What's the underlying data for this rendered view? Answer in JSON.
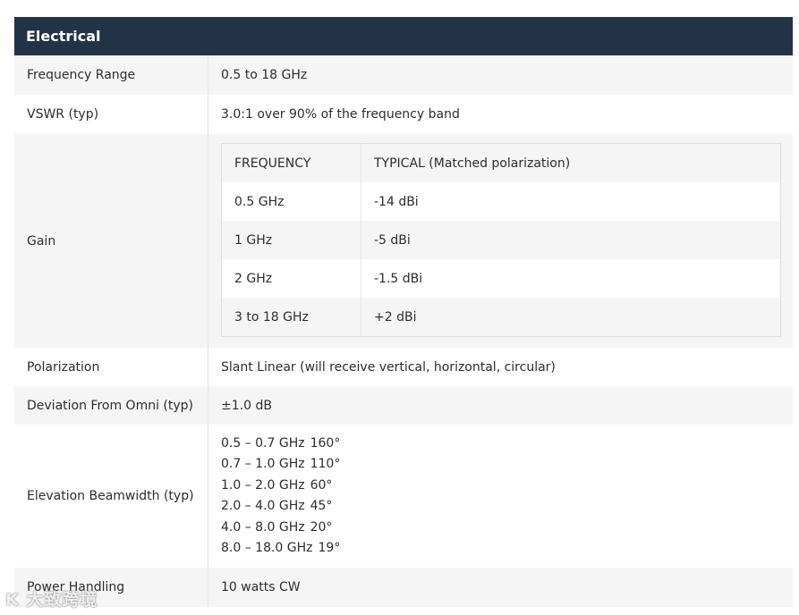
{
  "section_title": "Electrical",
  "rows": {
    "frequency_range": {
      "label": "Frequency Range",
      "value": "0.5 to 18 GHz"
    },
    "vswr": {
      "label": "VSWR (typ)",
      "value": "3.0:1 over 90% of the frequency band"
    },
    "gain": {
      "label": "Gain",
      "table": {
        "headers": [
          "FREQUENCY",
          "TYPICAL (Matched polarization)"
        ],
        "rows": [
          [
            "0.5 GHz",
            "-14 dBi"
          ],
          [
            "1 GHz",
            "-5 dBi"
          ],
          [
            "2 GHz",
            "-1.5 dBi"
          ],
          [
            "3 to 18 GHz",
            "+2 dBi"
          ]
        ]
      }
    },
    "polarization": {
      "label": "Polarization",
      "value": "Slant Linear (will receive vertical, horizontal, circular)"
    },
    "deviation": {
      "label": "Deviation From Omni (typ)",
      "value": "±1.0 dB"
    },
    "beamwidth": {
      "label": "Elevation Beamwidth (typ)",
      "lines": [
        {
          "range": "0.5 – 0.7 GHz",
          "angle": "160°"
        },
        {
          "range": "0.7 – 1.0 GHz",
          "angle": "110°"
        },
        {
          "range": "1.0 – 2.0 GHz",
          "angle": "60°"
        },
        {
          "range": "2.0 – 4.0 GHz",
          "angle": "45°"
        },
        {
          "range": "4.0 – 8.0 GHz",
          "angle": "20°"
        },
        {
          "range": "8.0 – 18.0 GHz",
          "angle": "19°"
        }
      ]
    },
    "power": {
      "label": "Power Handling",
      "value": "10 watts CW"
    }
  },
  "watermark": "K 大致跨境"
}
